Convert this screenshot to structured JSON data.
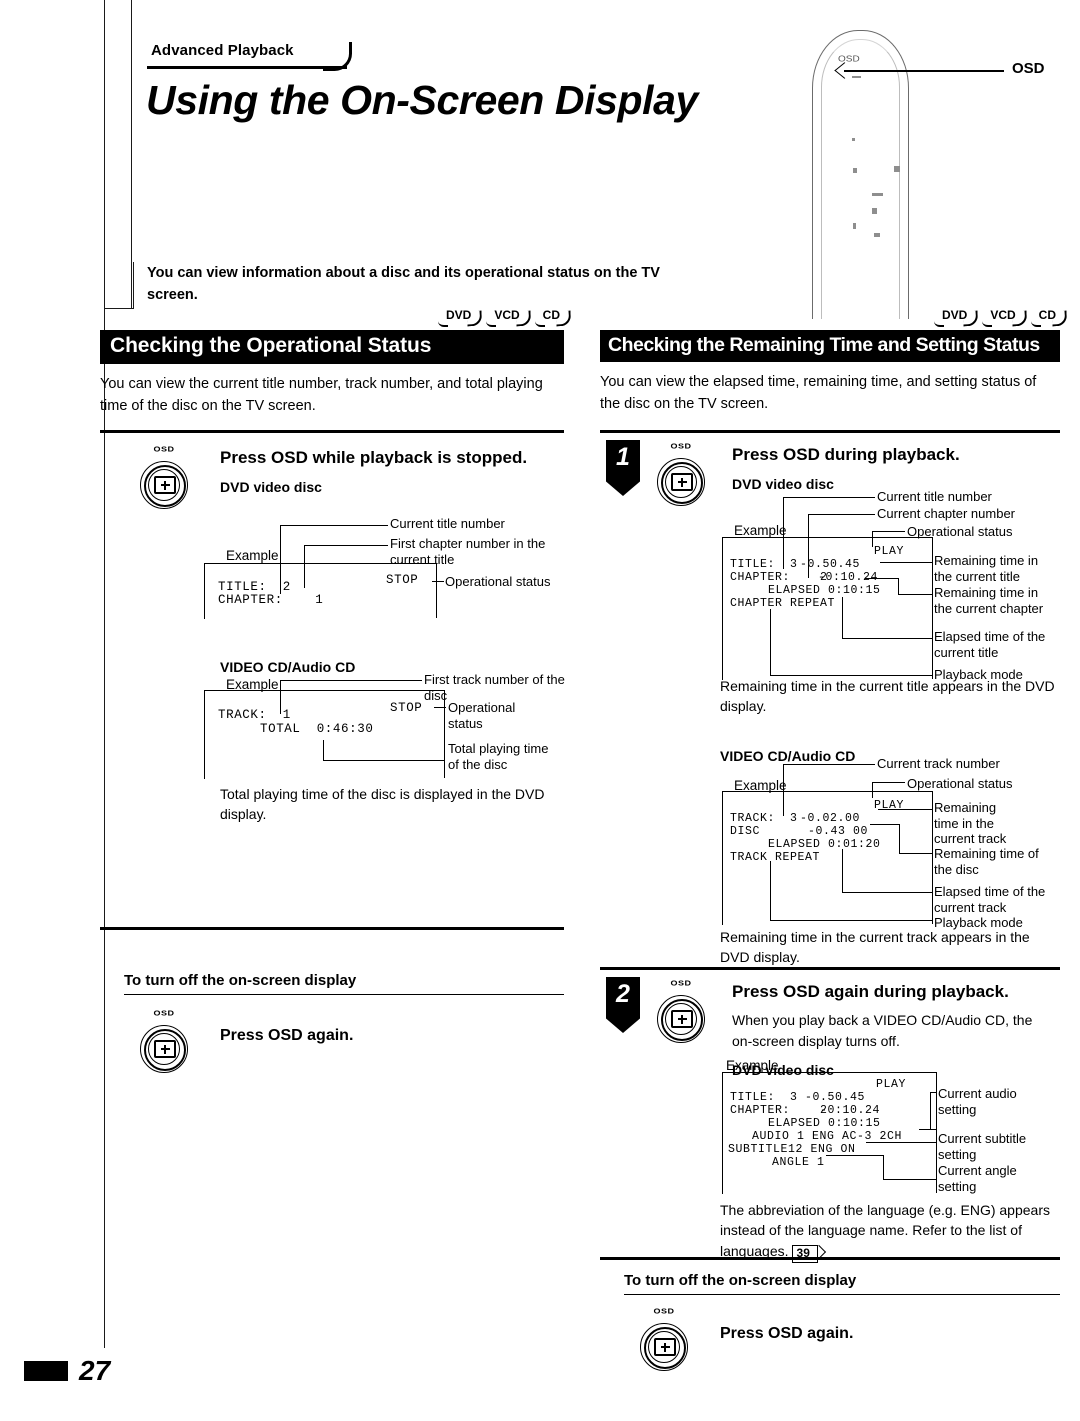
{
  "document": {
    "chapter_tab": "Advanced Playback",
    "title": "Using the On-Screen Display",
    "intro": "You can view information about a disc and its operational status on the TV screen.",
    "page_number": "27"
  },
  "remote": {
    "callout_label": "OSD",
    "button_mark": "OSD"
  },
  "disc_badges": [
    "DVD",
    "VCD",
    "CD"
  ],
  "left_column": {
    "section_title": "Checking the Operational Status",
    "section_desc": "You can view the current title number, track number, and total playing time of the disc on the TV screen.",
    "step": {
      "button_label": "OSD",
      "title": "Press OSD while playback is stopped."
    },
    "dvd": {
      "heading": "DVD video disc",
      "example_label": "Example",
      "callouts": {
        "title_number": "Current title number",
        "chapter_number": "First chapter number in the current title",
        "status": "Operational status"
      },
      "screen": {
        "line1": "TITLE:  2",
        "line2": "CHAPTER:    1",
        "status": "STOP"
      }
    },
    "cd": {
      "heading": "VIDEO CD/Audio CD",
      "example_label": "Example",
      "callouts": {
        "track_number": "First track number of the disc",
        "status": "Operational status",
        "total_time": "Total playing time of the disc"
      },
      "screen": {
        "line1": "TRACK:  1",
        "line2": "TOTAL  0:46:30",
        "status": "STOP"
      },
      "note": "Total playing time of the disc is displayed in the DVD display."
    },
    "turn_off": {
      "heading": "To turn off the on-screen display",
      "button_label": "OSD",
      "instruction": "Press OSD again."
    }
  },
  "right_column": {
    "section_title": "Checking the Remaining Time and Setting Status",
    "section_desc": "You can view the elapsed time, remaining time, and setting status of the disc on the TV screen.",
    "step1": {
      "number": "1",
      "button_label": "OSD",
      "title": "Press OSD during playback.",
      "dvd": {
        "heading": "DVD video disc",
        "example_label": "Example",
        "callouts": {
          "title_number": "Current title number",
          "chapter_number": "Current chapter number",
          "status": "Operational status",
          "remaining_title": "Remaining time in the current title",
          "remaining_chapter": "Remaining time in the current chapter",
          "elapsed_title": "Elapsed time of the current title",
          "playback_mode": "Playback mode"
        },
        "screen": {
          "status": "PLAY",
          "line1": "TITLE:  3",
          "line1_time": "-0.50.45",
          "line2": "CHAPTER:    2",
          "line2_time": "-0:10.24",
          "line3": "ELAPSED 0:10:15",
          "line4": "CHAPTER REPEAT"
        },
        "note": "Remaining time in the current title appears in the DVD display."
      },
      "cd": {
        "heading": "VIDEO CD/Audio CD",
        "example_label": "Example",
        "callouts": {
          "track_number": "Current track number",
          "status": "Operational status",
          "remaining_track": "Remaining time in the current track",
          "remaining_disc": "Remaining time of the disc",
          "elapsed_track": "Elapsed time of the current track",
          "playback_mode": "Playback mode"
        },
        "screen": {
          "status": "PLAY",
          "line1": "TRACK:  3",
          "line1_time": "-0.02.00",
          "line2": "DISC",
          "line2_time": "-0.43 00",
          "line3": "ELAPSED 0:01:20",
          "line4": "TRACK REPEAT"
        },
        "note": "Remaining time in the current track appears in the DVD display."
      }
    },
    "step2": {
      "number": "2",
      "button_label": "OSD",
      "title": "Press OSD again during playback.",
      "desc": "When you play back a VIDEO CD/Audio CD, the on-screen display turns off.",
      "dvd": {
        "heading": "DVD video disc",
        "example_label": "Example",
        "callouts": {
          "audio": "Current audio setting",
          "subtitle": "Current subtitle setting",
          "angle": "Current angle setting"
        },
        "screen": {
          "status": "PLAY",
          "line1": "TITLE:  3",
          "line1_time": "-0.50.45",
          "line2": "CHAPTER:    2",
          "line2_time": "-0:10.24",
          "line3": "ELAPSED 0:10:15",
          "line4": "AUDIO 1 ENG AC-3 2CH",
          "line5": "SUBTITLE12 ENG ON",
          "line6": "ANGLE 1"
        }
      },
      "note_prefix": "The abbreviation of the language (e.g. ENG) appears instead of the language name. Refer to the list of languages.",
      "note_page": "39"
    },
    "turn_off": {
      "heading": "To turn off the on-screen display",
      "button_label": "OSD",
      "instruction": "Press OSD again."
    }
  }
}
